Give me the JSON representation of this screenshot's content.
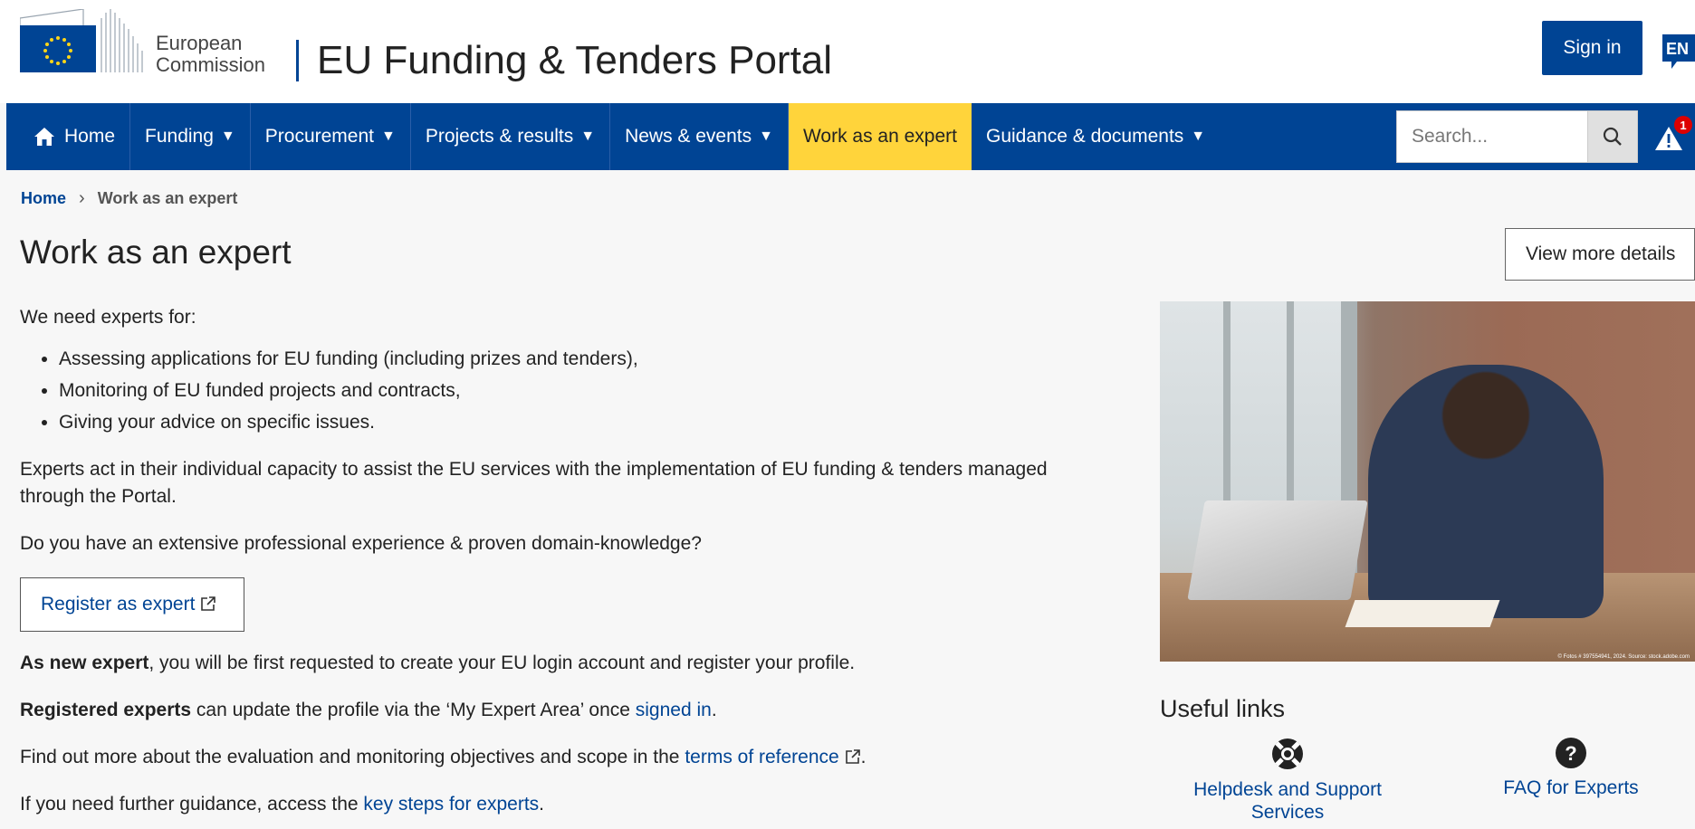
{
  "header": {
    "logo_text_line1": "European",
    "logo_text_line2": "Commission",
    "portal_title": "EU Funding & Tenders Portal",
    "signin_label": "Sign in",
    "lang_label": "EN"
  },
  "nav": {
    "items": [
      {
        "label": "Home"
      },
      {
        "label": "Funding"
      },
      {
        "label": "Procurement"
      },
      {
        "label": "Projects & results"
      },
      {
        "label": "News & events"
      },
      {
        "label": "Work as an expert"
      },
      {
        "label": "Guidance & documents"
      }
    ],
    "search_placeholder": "Search...",
    "alert_count": "1"
  },
  "breadcrumb": {
    "home": "Home",
    "current": "Work as an expert"
  },
  "page": {
    "title": "Work as an expert",
    "more_details_label": "View more details",
    "intro": "We need experts for:",
    "list": [
      "Assessing applications for EU funding (including prizes and tenders),",
      "Monitoring of EU funded projects and contracts,",
      "Giving your advice on specific issues."
    ],
    "act_text": "Experts act in their individual capacity to assist the EU services with the implementation of EU funding & tenders managed through the Portal.",
    "question": "Do you have an extensive professional experience & proven domain-knowledge?",
    "register_label": "Register as expert",
    "new_expert_bold": "As new expert",
    "new_expert_rest": ", you will be first requested to create your EU login account and register your profile.",
    "registered_bold": "Registered experts",
    "registered_rest": " can update the profile via the ‘My Expert Area’ once ",
    "signed_in_link": "signed in",
    "period": ".",
    "find_text": "Find out more about the evaluation and monitoring objectives and scope in the ",
    "terms_link": "terms of reference",
    "guide_text": "If you need further guidance, access the ",
    "key_steps_link": "key steps for experts"
  },
  "sidebar": {
    "image_credit": "© Fotos # 397554941, 2024. Source: stock.adobe.com",
    "useful_links_title": "Useful links",
    "links": [
      {
        "label": "Helpdesk and Support Services",
        "icon": "lifebuoy-icon"
      },
      {
        "label": "FAQ for Experts",
        "icon": "question-circle-icon"
      }
    ]
  },
  "colors": {
    "brand_blue": "#004494",
    "active_yellow": "#ffd43b",
    "alert_red": "#dd0000"
  }
}
